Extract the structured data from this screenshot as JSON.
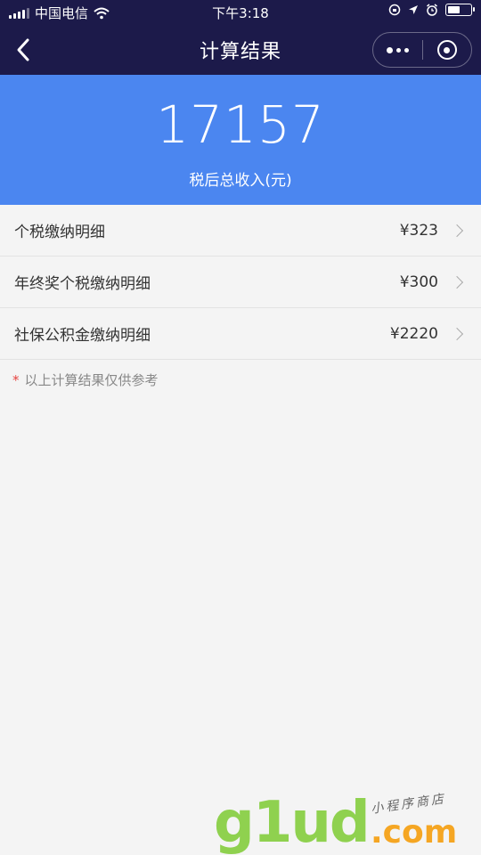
{
  "status_bar": {
    "carrier": "中国电信",
    "time": "下午3:18",
    "battery_level": 0.55
  },
  "nav": {
    "title": "计算结果"
  },
  "summary": {
    "amount": "17157",
    "label": "税后总收入(元)"
  },
  "items": [
    {
      "label": "个税缴纳明细",
      "value": "¥323"
    },
    {
      "label": "年终奖个税缴纳明细",
      "value": "¥300"
    },
    {
      "label": "社保公积金缴纳明细",
      "value": "¥2220"
    }
  ],
  "note": {
    "star": "*",
    "text": "以上计算结果仅供参考"
  },
  "watermark": {
    "main": "g1ud",
    "domain": ".com",
    "tagline": "小程序商店"
  },
  "colors": {
    "nav_bg": "#1c1a4a",
    "accent": "#4b86f0",
    "required_star": "#e64340"
  }
}
